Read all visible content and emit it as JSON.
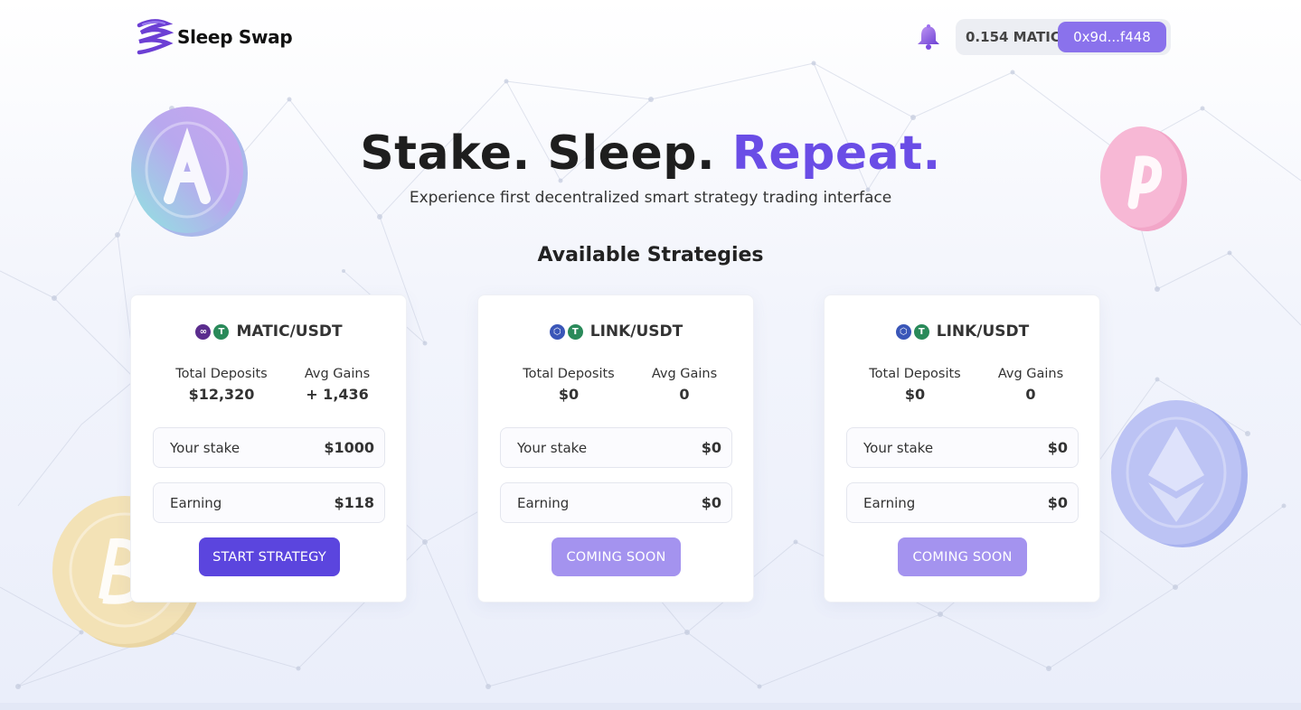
{
  "header": {
    "brand": "Sleep Swap",
    "balance": "0.154 MATIC",
    "address": "0x9d...f448"
  },
  "hero": {
    "title_part1": "Stake. Sleep. ",
    "title_part2": "Repeat.",
    "subtitle": "Experience first decentralized smart strategy trading interface"
  },
  "section": {
    "title": "Available Strategies"
  },
  "strategies": [
    {
      "pair": "MATIC/USDT",
      "tokens": [
        "matic-token-icon",
        "usdt-token-icon"
      ],
      "total_deposits_label": "Total Deposits",
      "total_deposits": "$12,320",
      "avg_gains_label": "Avg Gains",
      "avg_gains": "+ 1,436",
      "stake_label": "Your stake",
      "stake": "$1000",
      "earning_label": "Earning",
      "earning": "$118",
      "button": "START STRATEGY"
    },
    {
      "pair": "LINK/USDT",
      "tokens": [
        "link-token-icon",
        "usdt-token-icon"
      ],
      "total_deposits_label": "Total Deposits",
      "total_deposits": "$0",
      "avg_gains_label": "Avg Gains",
      "avg_gains": "0",
      "stake_label": "Your stake",
      "stake": "$0",
      "earning_label": "Earning",
      "earning": "$0",
      "button": "COMING SOON"
    },
    {
      "pair": "LINK/USDT",
      "tokens": [
        "link-token-icon",
        "usdt-token-icon"
      ],
      "total_deposits_label": "Total Deposits",
      "total_deposits": "$0",
      "avg_gains_label": "Avg Gains",
      "avg_gains": "0",
      "stake_label": "Your stake",
      "stake": "$0",
      "earning_label": "Earning",
      "earning": "$0",
      "button": "COMING SOON"
    }
  ],
  "colors": {
    "accent": "#6a4de6",
    "primary_button": "#5b45de",
    "disabled_button": "#a493ef",
    "address_pill": "#8a72ec"
  },
  "decorations": [
    "aave-coin-icon",
    "polkadot-coin-icon",
    "ethereum-coin-icon",
    "bitcoin-coin-icon",
    "network-background"
  ]
}
